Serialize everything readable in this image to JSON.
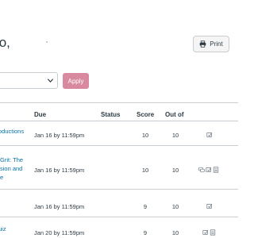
{
  "page": {
    "title": "to,",
    "print_label": "Print",
    "apply_label": "Apply"
  },
  "table": {
    "headers": {
      "due": "Due",
      "status": "Status",
      "score": "Score",
      "out_of": "Out of"
    },
    "rows": [
      {
        "name_lines": [
          "oductions"
        ],
        "due": "Jan 16 by 11:59pm",
        "score": "10",
        "out_of": "10",
        "icons": [
          "submission-icon"
        ]
      },
      {
        "name_lines": [
          "Grit: The",
          "sion and",
          "e"
        ],
        "due": "Jan 16 by 11:59pm",
        "score": "10",
        "out_of": "10",
        "icons": [
          "comments-icon",
          "submission-icon",
          "rubric-icon"
        ]
      },
      {
        "name_lines": [
          "t"
        ],
        "due": "Jan 16 by 11:59pm",
        "score": "9",
        "out_of": "10",
        "icons": [
          "submission-icon"
        ]
      },
      {
        "name_lines": [
          "uiz"
        ],
        "due": "Jan 20 by 11:59pm",
        "score": "9",
        "out_of": "10",
        "icons": [
          "submission-icon",
          "rubric-icon"
        ]
      }
    ]
  },
  "colors": {
    "link": "#0770a3",
    "apply_button": "#d9899f",
    "border": "#c7cdd1",
    "text": "#2d3b45"
  }
}
